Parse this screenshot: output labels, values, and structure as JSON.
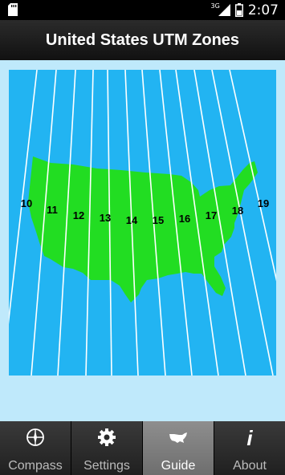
{
  "status_bar": {
    "network": "3G",
    "time": "2:07"
  },
  "app_bar": {
    "title": "United States UTM Zones"
  },
  "map": {
    "zones": [
      "10",
      "11",
      "12",
      "13",
      "14",
      "15",
      "16",
      "17",
      "18",
      "19"
    ],
    "colors": {
      "ocean": "#22b4f2",
      "land": "#22dd22",
      "line": "#ffffff"
    }
  },
  "tabs": [
    {
      "label": "Compass",
      "icon": "compass-icon"
    },
    {
      "label": "Settings",
      "icon": "gear-icon"
    },
    {
      "label": "Guide",
      "icon": "us-map-icon",
      "active": true
    },
    {
      "label": "About",
      "icon": "info-icon"
    }
  ]
}
